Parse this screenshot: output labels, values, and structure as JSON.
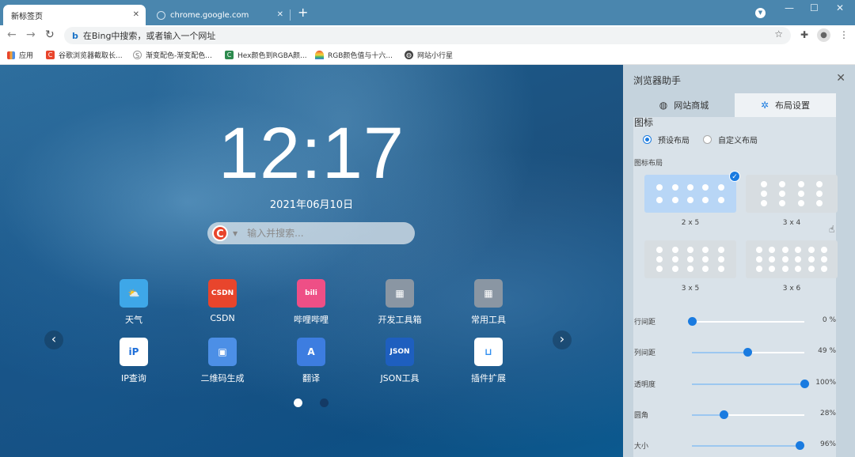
{
  "browser": {
    "tabs": [
      {
        "title": "新标签页",
        "active": true
      },
      {
        "title": "chrome.google.com",
        "active": false
      }
    ],
    "new_tab_symbol": "+",
    "close_symbol": "✕",
    "window_controls": [
      "—",
      "☐",
      "✕"
    ],
    "omnibox_placeholder": "在Bing中搜索，或者输入一个网址",
    "bookmarks": [
      {
        "label": "应用",
        "icon": "apps-grid-icon",
        "color": "#e8452c"
      },
      {
        "label": "谷歌浏览器截取长...",
        "icon": "c-logo-icon",
        "color": "#e8452c"
      },
      {
        "label": "渐变配色-渐变配色...",
        "icon": "gradient-logo-icon",
        "color": "#6b6b6b"
      },
      {
        "label": "Hex颜色到RGBA颜...",
        "icon": "c-logo-icon",
        "color": "#2d8a4e"
      },
      {
        "label": "RGB颜色值与十六...",
        "icon": "rainbow-icon",
        "color": "#f2a23a"
      },
      {
        "label": "网站小行星",
        "icon": "globe-icon",
        "color": "#444444"
      }
    ]
  },
  "newtab": {
    "clock": "12:17",
    "date": "2021年06月10日",
    "search_placeholder": "输入并搜索...",
    "search_engine_logo": "C",
    "apps": [
      {
        "label": "天气",
        "icon": "weather-icon",
        "color": "#3ea7e8",
        "glyph": "⛅"
      },
      {
        "label": "CSDN",
        "icon": "csdn-icon",
        "color": "#e8452c",
        "glyph": "CSDN"
      },
      {
        "label": "哔哩哔哩",
        "icon": "bilibili-icon",
        "color": "#ee4f86",
        "glyph": "bili"
      },
      {
        "label": "开发工具箱",
        "icon": "dev-toolbox-icon",
        "color": "#8a96a3",
        "glyph": "▦"
      },
      {
        "label": "常用工具",
        "icon": "common-tools-icon",
        "color": "#8a96a3",
        "glyph": "▦"
      },
      {
        "label": "IP查询",
        "icon": "ip-lookup-icon",
        "color": "#ffffff",
        "glyph": "iP"
      },
      {
        "label": "二维码生成",
        "icon": "qrcode-icon",
        "color": "#4c8fe6",
        "glyph": "▣"
      },
      {
        "label": "翻译",
        "icon": "translate-icon",
        "color": "#3d7de0",
        "glyph": "A"
      },
      {
        "label": "JSON工具",
        "icon": "json-tool-icon",
        "color": "#1e5fbf",
        "glyph": "JSON"
      },
      {
        "label": "插件扩展",
        "icon": "extension-store-icon",
        "color": "#ffffff",
        "glyph": "⊔"
      }
    ],
    "page_indicator": {
      "current": 1,
      "total": 2
    }
  },
  "panel": {
    "title": "浏览器助手",
    "tabs": [
      {
        "label": "网站商城",
        "icon": "globe-icon",
        "active": false
      },
      {
        "label": "布局设置",
        "icon": "gear-icon",
        "active": true
      }
    ],
    "icon_section_title": "图标",
    "layout_modes": [
      {
        "label": "预设布局",
        "selected": true
      },
      {
        "label": "自定义布局",
        "selected": false
      }
    ],
    "grid_section_title": "图标布局",
    "grid_options": [
      {
        "label": "2 x 5",
        "rows": 2,
        "cols": 5,
        "selected": true
      },
      {
        "label": "3 x 4",
        "rows": 3,
        "cols": 4,
        "selected": false
      },
      {
        "label": "3 x 5",
        "rows": 3,
        "cols": 5,
        "selected": false
      },
      {
        "label": "3 x 6",
        "rows": 3,
        "cols": 6,
        "selected": false
      }
    ],
    "sliders": [
      {
        "label": "行间距",
        "value": 0,
        "display": "0 %"
      },
      {
        "label": "列间距",
        "value": 49,
        "display": "49 %"
      },
      {
        "label": "透明度",
        "value": 100,
        "display": "100%"
      },
      {
        "label": "圆角",
        "value": 28,
        "display": "28%"
      },
      {
        "label": "大小",
        "value": 96,
        "display": "96%"
      }
    ],
    "close_symbol": "✕",
    "selected_check": "✓"
  }
}
